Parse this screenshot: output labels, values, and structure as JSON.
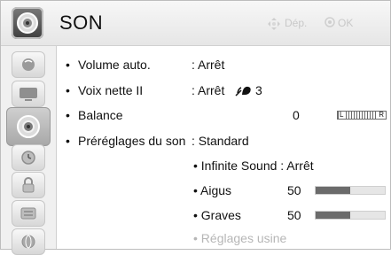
{
  "header": {
    "title": "SON",
    "hint_move_icon": "dpad-icon",
    "hint_move": "Dép.",
    "hint_ok_icon": "ok-circle-icon",
    "hint_ok": "OK"
  },
  "sidebar": {
    "items": [
      {
        "icon": "picture-icon",
        "selected": false
      },
      {
        "icon": "screen-icon",
        "selected": false
      },
      {
        "icon": "speaker-icon",
        "selected": true
      },
      {
        "icon": "clock-icon",
        "selected": false
      },
      {
        "icon": "lock-icon",
        "selected": false
      },
      {
        "icon": "options-icon",
        "selected": false
      },
      {
        "icon": "globe-icon",
        "selected": false
      }
    ]
  },
  "settings": {
    "volume_auto": {
      "label": "Volume auto.",
      "value": ": Arrêt"
    },
    "voix_nette": {
      "label": "Voix nette II",
      "value": ": Arrêt",
      "level": "3"
    },
    "balance": {
      "label": "Balance",
      "value": "0",
      "left_label": "L",
      "right_label": "R"
    },
    "preglages": {
      "label": "Préréglages du son",
      "value": ": Standard"
    },
    "infinite": {
      "label": "• Infinite Sound : Arrêt"
    },
    "aigus": {
      "label": "• Aigus",
      "value": "50",
      "level": 0.5
    },
    "graves": {
      "label": "• Graves",
      "value": "50",
      "level": 0.5
    },
    "reglages_usine": {
      "label": "• Réglages usine"
    }
  },
  "colors": {
    "bar_fill": "#6b6b6b",
    "disabled_text": "#b6b6b6"
  }
}
